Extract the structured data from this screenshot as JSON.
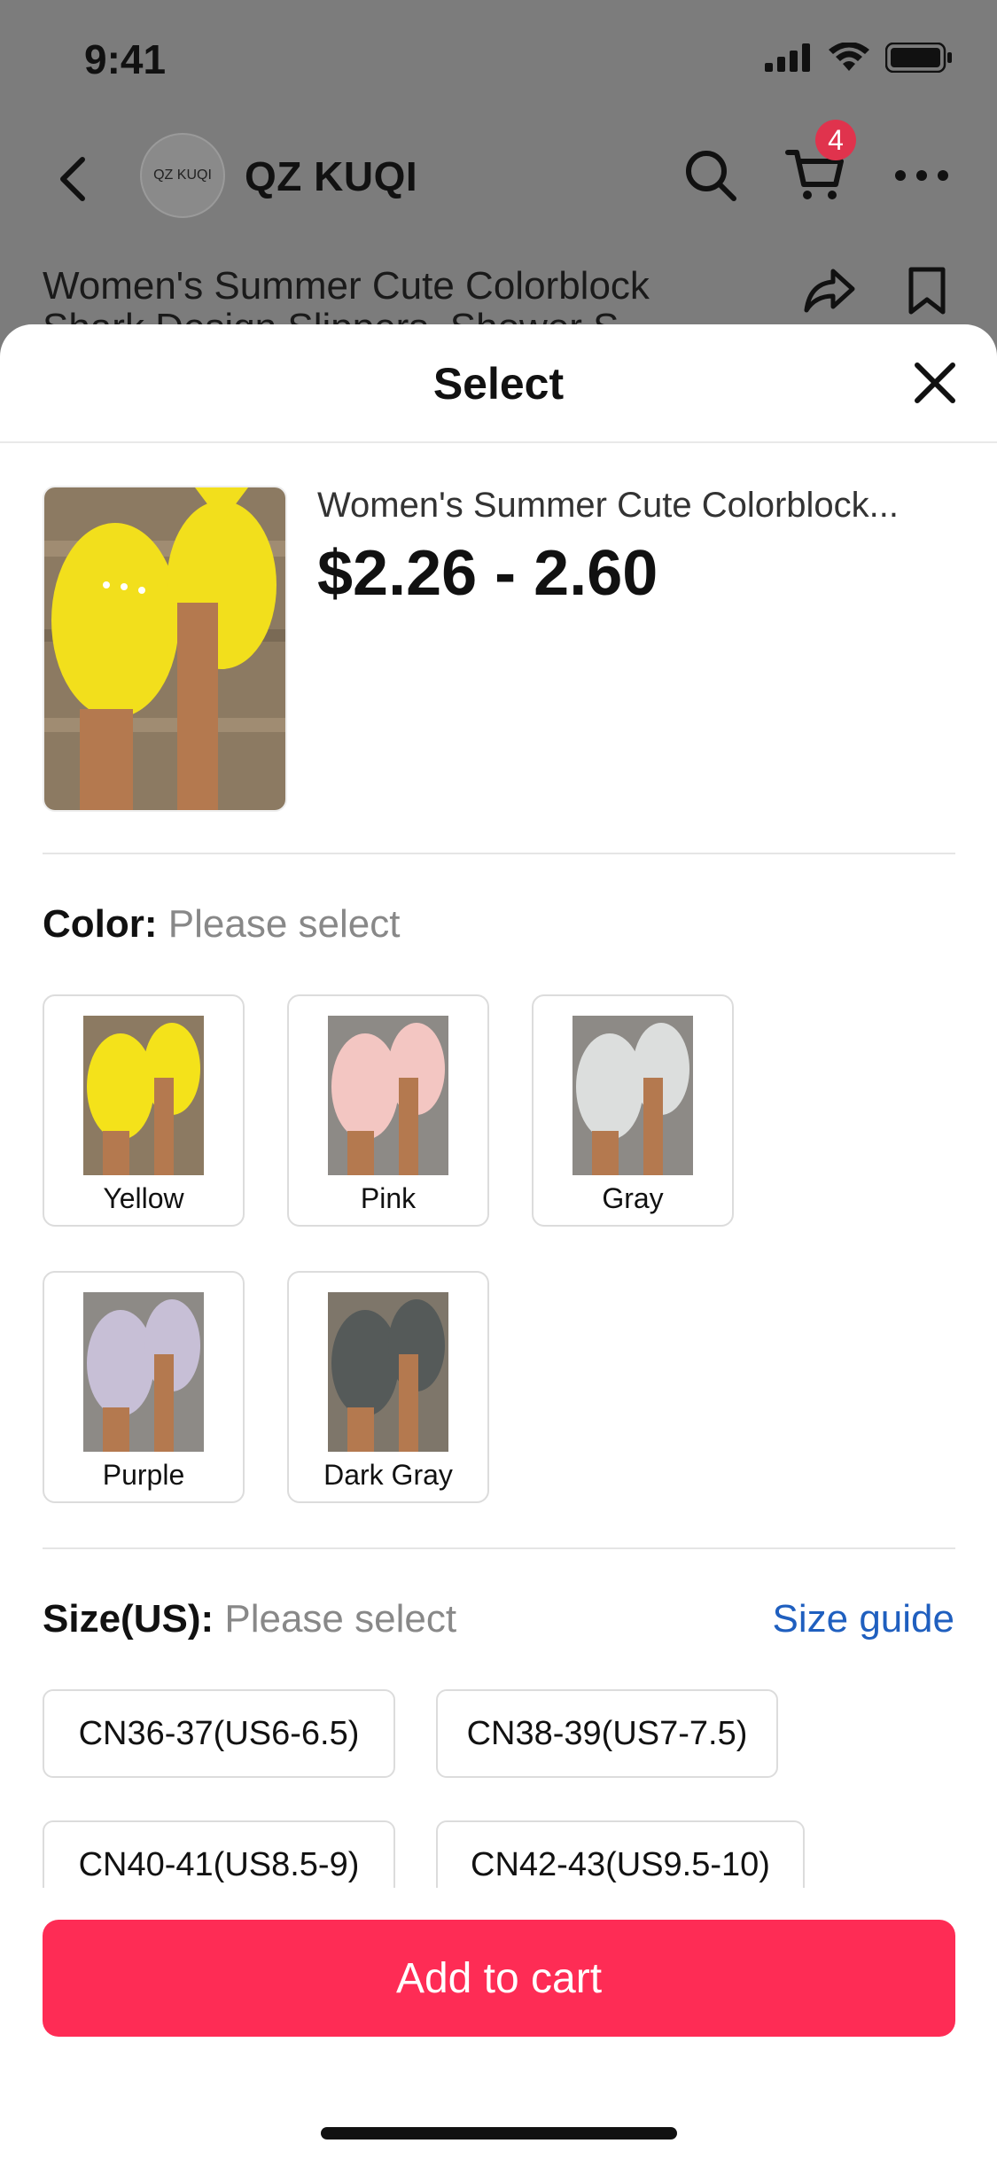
{
  "status_bar": {
    "time": "9:41"
  },
  "header": {
    "shop_logo_text": "QZ KUQI",
    "shop_name": "QZ KUQI",
    "cart_badge": "4"
  },
  "background": {
    "product_title_line1": "Women's Summer Cute Colorblock",
    "product_title_line2": "Shark Design Slippers, Shower S..."
  },
  "sheet": {
    "title": "Select",
    "product": {
      "name": "Women's Summer Cute Colorblock...",
      "price": "$2.26 - 2.60"
    },
    "color": {
      "label": "Color:",
      "hint": "Please select",
      "options": [
        "Yellow",
        "Pink",
        "Gray",
        "Purple",
        "Dark Gray"
      ]
    },
    "size": {
      "label": "Size(US):",
      "hint": "Please select",
      "guide": "Size guide",
      "options": [
        "CN36-37(US6-6.5)",
        "CN38-39(US7-7.5)",
        "CN40-41(US8.5-9)",
        "CN42-43(US9.5-10)"
      ]
    },
    "add_to_cart": "Add to cart"
  },
  "colors": {
    "accent": "#fe2c55",
    "link": "#1f5fbf",
    "badge": "#e0334d",
    "swatch_yellow": "#f4e21a",
    "swatch_pink": "#f3c6c2",
    "swatch_gray": "#dcdedd",
    "swatch_purple": "#c7bfd6",
    "swatch_darkgray": "#555a59"
  }
}
